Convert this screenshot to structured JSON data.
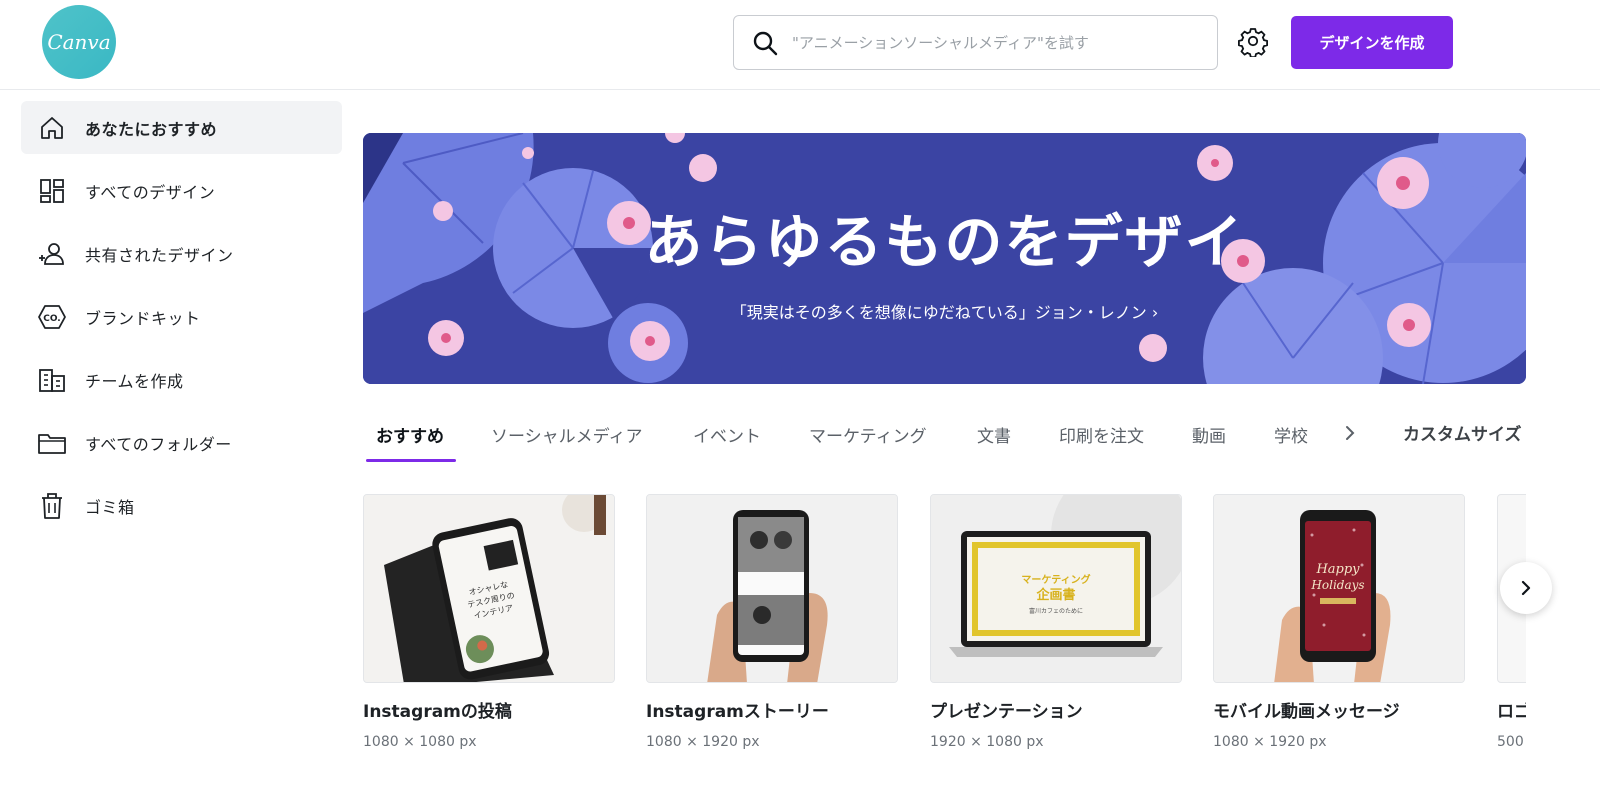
{
  "header": {
    "logo_text": "Canva",
    "search_placeholder": "\"アニメーションソーシャルメディア\"を試す",
    "create_button": "デザインを作成",
    "icons": {
      "search": "search-icon",
      "settings": "gear-icon"
    }
  },
  "sidebar": {
    "items": [
      {
        "label": "あなたにおすすめ",
        "icon": "home-icon",
        "active": true
      },
      {
        "label": "すべてのデザイン",
        "icon": "grid-icon"
      },
      {
        "label": "共有されたデザイン",
        "icon": "shared-users-icon"
      },
      {
        "label": "ブランドキット",
        "icon": "brand-kit-icon"
      },
      {
        "label": "チームを作成",
        "icon": "building-icon"
      },
      {
        "label": "すべてのフォルダー",
        "icon": "folder-icon"
      },
      {
        "label": "ゴミ箱",
        "icon": "trash-icon"
      }
    ]
  },
  "banner": {
    "title": "あらゆるものをデザイ",
    "quote": "「現実はその多くを想像にゆだねている」ジョン・レノン ›"
  },
  "tabs": {
    "items": [
      "おすすめ",
      "ソーシャルメディア",
      "イベント",
      "マーケティング",
      "文書",
      "印刷を注文",
      "動画",
      "学校"
    ],
    "custom_size": "カスタムサイズ"
  },
  "cards": [
    {
      "name": "Instagramの投稿",
      "size": "1080 × 1080 px"
    },
    {
      "name": "Instagramストーリー",
      "size": "1080 × 1920 px"
    },
    {
      "name": "プレゼンテーション",
      "size": "1920 × 1080 px"
    },
    {
      "name": "モバイル動画メッセージ",
      "size": "1080 × 1920 px"
    },
    {
      "name": "ロゴ",
      "size": "500"
    }
  ],
  "thumb_text": {
    "instagram_post": [
      "オシャレな",
      "テスク周りの",
      "インテリア"
    ],
    "presentation": [
      "マーケティング",
      "企画書",
      "富川カフェのために"
    ],
    "mobile_message": [
      "Happy",
      "Holidays"
    ]
  },
  "colors": {
    "accent": "#7d2ae8",
    "banner_bg": "#3b44a3",
    "logo": "#20c4cb"
  }
}
